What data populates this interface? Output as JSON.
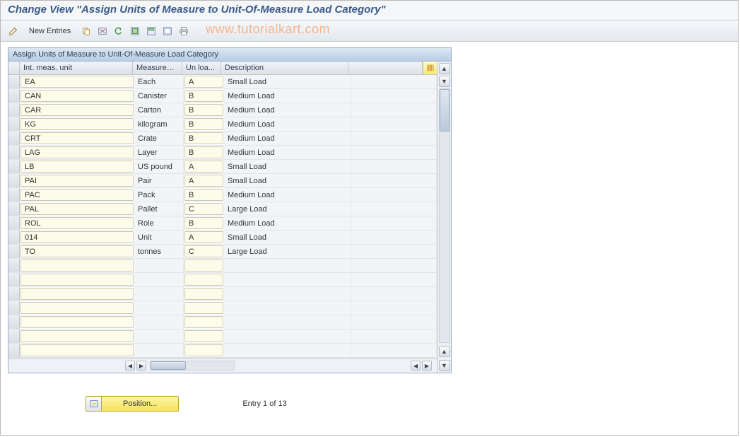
{
  "title": "Change View \"Assign Units of Measure to Unit-Of-Measure Load Category\"",
  "toolbar": {
    "new_entries_label": "New Entries"
  },
  "watermark": "www.tutorialkart.com",
  "panel": {
    "title": "Assign Units of Measure to Unit-Of-Measure Load Category",
    "columns": {
      "c1": "Int. meas. unit",
      "c2": "Measurem...",
      "c3": "Un loa...",
      "c4": "Description"
    },
    "rows": [
      {
        "unit": "EA",
        "meas": "Each",
        "load": "A",
        "desc": "Small Load"
      },
      {
        "unit": "CAN",
        "meas": "Canister",
        "load": "B",
        "desc": "Medium Load"
      },
      {
        "unit": "CAR",
        "meas": "Carton",
        "load": "B",
        "desc": "Medium Load"
      },
      {
        "unit": "KG",
        "meas": "kilogram",
        "load": "B",
        "desc": "Medium Load"
      },
      {
        "unit": "CRT",
        "meas": "Crate",
        "load": "B",
        "desc": "Medium Load"
      },
      {
        "unit": "LAG",
        "meas": "Layer",
        "load": "B",
        "desc": "Medium Load"
      },
      {
        "unit": "LB",
        "meas": "US pound",
        "load": "A",
        "desc": "Small Load"
      },
      {
        "unit": "PAI",
        "meas": "Pair",
        "load": "A",
        "desc": "Small Load"
      },
      {
        "unit": "PAC",
        "meas": "Pack",
        "load": "B",
        "desc": "Medium Load"
      },
      {
        "unit": "PAL",
        "meas": "Pallet",
        "load": "C",
        "desc": "Large Load"
      },
      {
        "unit": "ROL",
        "meas": "Role",
        "load": "B",
        "desc": "Medium Load"
      },
      {
        "unit": "014",
        "meas": "Unit",
        "load": "A",
        "desc": "Small Load"
      },
      {
        "unit": "TO",
        "meas": "tonnes",
        "load": "C",
        "desc": "Large Load"
      }
    ],
    "empty_rows": 7
  },
  "footer": {
    "position_label": "Position...",
    "entry_status": "Entry 1 of 13"
  }
}
